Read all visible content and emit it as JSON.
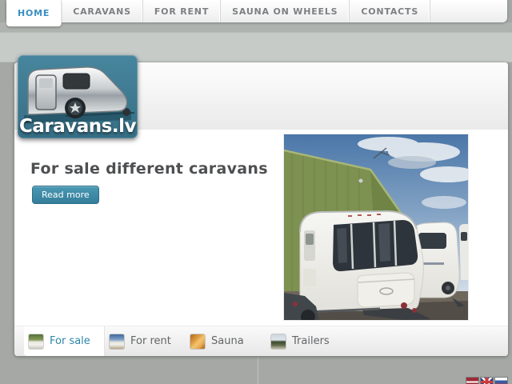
{
  "nav": {
    "items": [
      {
        "label": "HOME",
        "active": true
      },
      {
        "label": "CARAVANS",
        "active": false
      },
      {
        "label": "FOR RENT",
        "active": false
      },
      {
        "label": "SAUNA ON WHEELS",
        "active": false
      },
      {
        "label": "CONTACTS",
        "active": false
      }
    ]
  },
  "logo": {
    "text": "Caravans.lv"
  },
  "hero": {
    "title": "For sale different caravans",
    "button_label": "Read more"
  },
  "photo": {
    "description": "white caravans parked in front of a green barn under a blue sky"
  },
  "tabs": {
    "items": [
      {
        "label": "For sale",
        "active": true,
        "icon": "caravan-sale-thumb"
      },
      {
        "label": "For rent",
        "active": false,
        "icon": "caravan-rent-thumb"
      },
      {
        "label": "Sauna",
        "active": false,
        "icon": "sauna-thumb"
      },
      {
        "label": "Trailers",
        "active": false,
        "icon": "trailer-thumb"
      }
    ]
  },
  "footer": {
    "flags": [
      {
        "name": "latvian-flag"
      },
      {
        "name": "british-flag"
      },
      {
        "name": "russian-flag"
      }
    ]
  },
  "colors": {
    "accent_teal": "#3a8caa",
    "nav_active_blue": "#3a8fc0",
    "logo_background": "#3d7b93",
    "page_background": "#a5a8a5",
    "heading_gray": "#4d4f51"
  }
}
